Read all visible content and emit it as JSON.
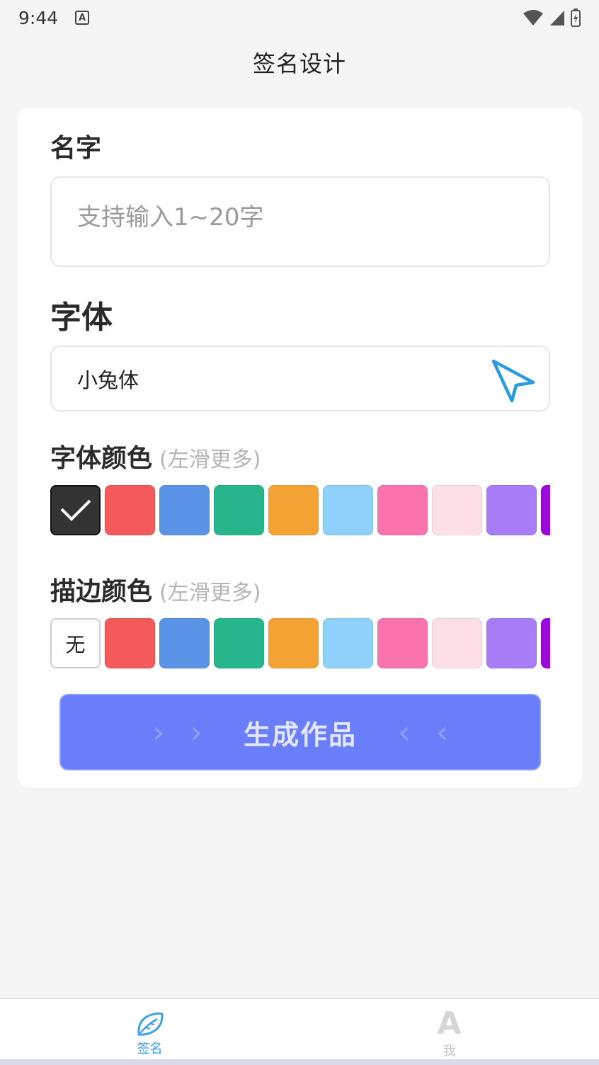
{
  "status_bar": {
    "time": "9:44",
    "a_icon_letter": "A"
  },
  "header": {
    "title": "签名设计"
  },
  "name_section": {
    "label": "名字",
    "placeholder": "支持输入1~20字",
    "value": ""
  },
  "font_section": {
    "label": "字体",
    "selected": "小兔体"
  },
  "font_color_section": {
    "label": "字体颜色",
    "hint": "(左滑更多)",
    "swatches": [
      "#333333",
      "#f45a5a",
      "#5b94e6",
      "#27b68b",
      "#f5a234",
      "#8fd1fb",
      "#fa73ad",
      "#fde0e6",
      "#a97cf8",
      "#9a0bd8"
    ],
    "selected_index": 0
  },
  "stroke_color_section": {
    "label": "描边颜色",
    "hint": "(左滑更多)",
    "none_label": "无",
    "swatches": [
      "#f45a5a",
      "#5b94e6",
      "#27b68b",
      "#f5a234",
      "#8fd1fb",
      "#fa73ad",
      "#fde0e6",
      "#a97cf8",
      "#9a0bd8"
    ]
  },
  "generate_button": {
    "label": "生成作品"
  },
  "tabbar": {
    "tabs": [
      {
        "label": "签名",
        "icon": "leaf-icon",
        "active": true
      },
      {
        "label": "我",
        "icon": "letter-a-icon",
        "active": false
      }
    ]
  },
  "colors": {
    "accent": "#6b7ef9",
    "tab_active": "#3aa0e8"
  }
}
